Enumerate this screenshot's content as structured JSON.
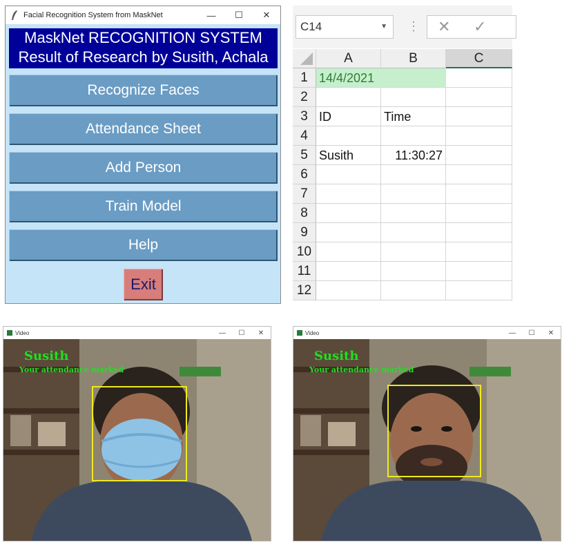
{
  "tk_window": {
    "title": "Facial Recognition System from MaskNet",
    "controls": {
      "minimize": "—",
      "maximize": "☐",
      "close": "✕"
    },
    "header_line1": "MaskNet RECOGNITION SYSTEM",
    "header_line2": "Result of Research by Susith, Achala",
    "buttons": [
      "Recognize Faces",
      "Attendance Sheet",
      "Add Person",
      "Train Model",
      "Help"
    ],
    "exit_label": "Exit"
  },
  "excel": {
    "name_box": "C14",
    "columns": [
      "A",
      "B",
      "C"
    ],
    "rows": [
      "1",
      "2",
      "3",
      "4",
      "5",
      "6",
      "7",
      "8",
      "9",
      "10",
      "11",
      "12"
    ],
    "cells": {
      "A1": "14/4/2021",
      "A3": "ID",
      "B3": "Time",
      "A5": "Susith",
      "B5": "11:30:27"
    }
  },
  "video_left": {
    "title": "Video",
    "controls": {
      "minimize": "—",
      "maximize": "☐",
      "close": "✕"
    },
    "name": "Susith",
    "message": "Your attendance marked"
  },
  "video_right": {
    "title": "Video",
    "controls": {
      "minimize": "—",
      "maximize": "☐",
      "close": "✕"
    },
    "name": "Susith",
    "message": "Your attendance marked"
  },
  "colors": {
    "tk_bg": "#c5e4f8",
    "header_bg": "#000099",
    "button_bg": "#6a9cc4",
    "exit_bg": "#d77e7b",
    "excel_selected_fill": "#c6efce",
    "excel_date_text": "#2e7d32",
    "overlay_text": "#1fe01f",
    "face_box": "#f0ea1c"
  }
}
